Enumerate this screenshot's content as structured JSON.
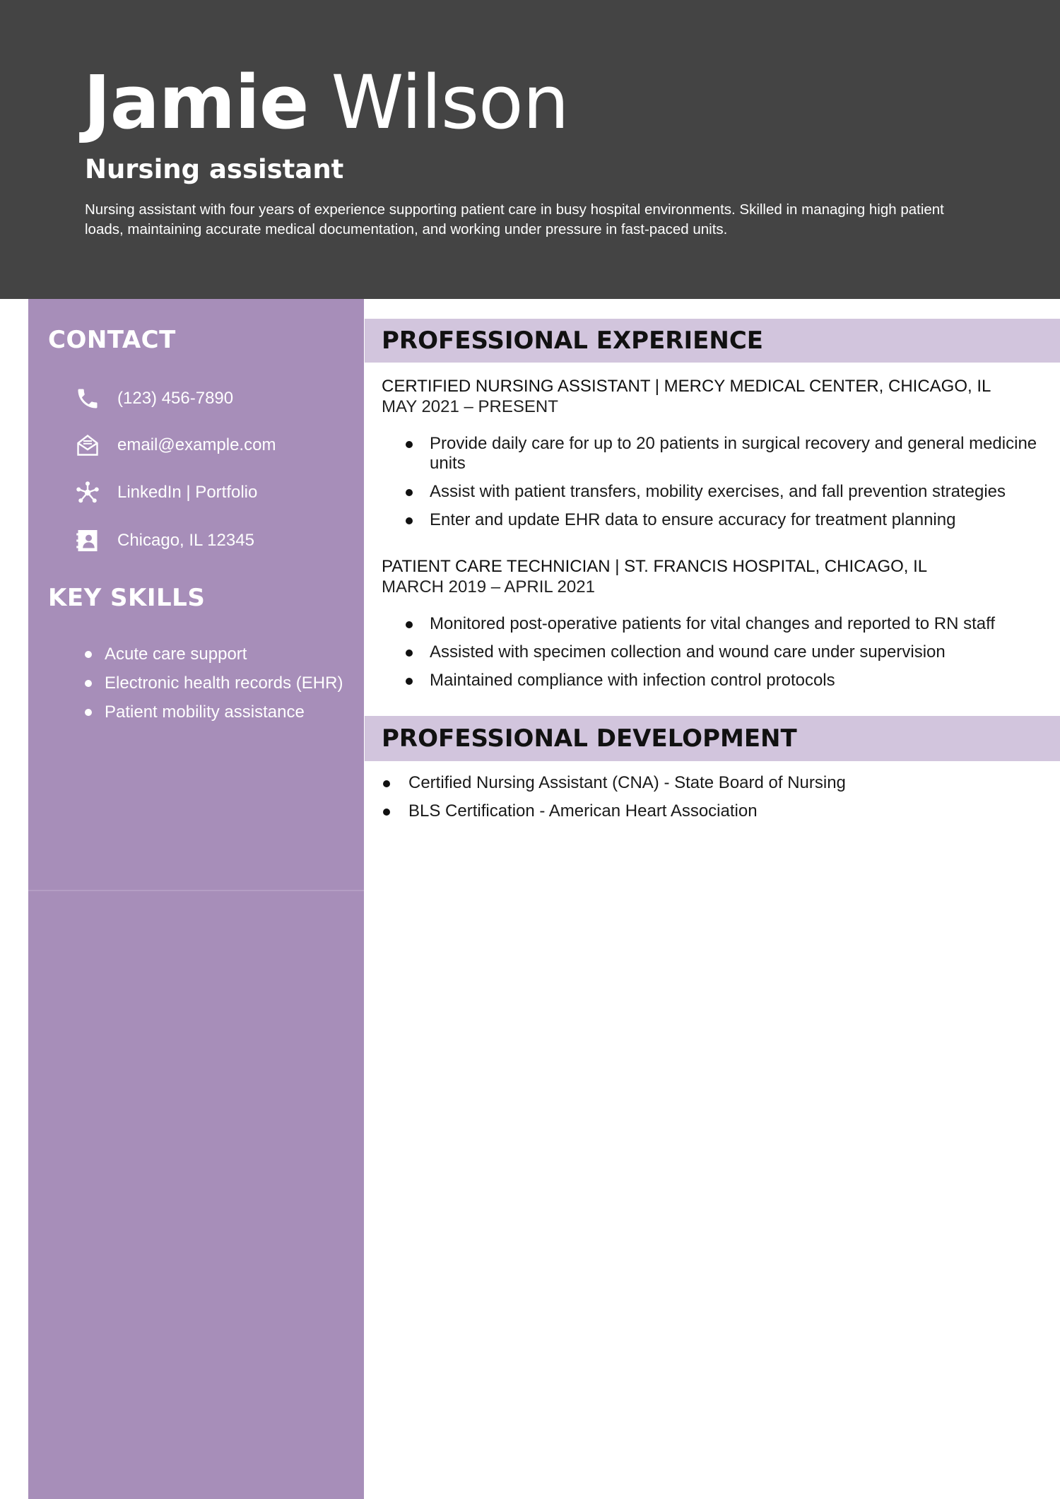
{
  "header": {
    "first_name": "Jamie",
    "last_name": "Wilson",
    "title": "Nursing assistant",
    "summary": "Nursing assistant with four years of experience supporting patient care in busy hospital environments. Skilled in managing high patient loads, maintaining accurate medical documentation, and working under pressure in fast-paced units."
  },
  "sidebar": {
    "contact_heading": "CONTACT",
    "contact": [
      {
        "icon": "phone-icon",
        "text": "(123) 456-7890"
      },
      {
        "icon": "envelope-icon",
        "text": "email@example.com"
      },
      {
        "icon": "network-icon",
        "text": "LinkedIn | Portfolio"
      },
      {
        "icon": "contact-card-icon",
        "text": "Chicago, IL 12345"
      }
    ],
    "skills_heading": "KEY SKILLS",
    "skills": [
      "Acute care support",
      "Electronic health records (EHR)",
      "Patient mobility assistance"
    ]
  },
  "experience": {
    "heading": "PROFESSIONAL EXPERIENCE",
    "jobs": [
      {
        "role": "CERTIFIED NURSING ASSISTANT | MERCY MEDICAL CENTER, CHICAGO, IL",
        "dates": "MAY 2021 – PRESENT",
        "bullets": [
          "Provide daily care for up to 20 patients in surgical recovery and general medicine units",
          "Assist with patient transfers, mobility exercises, and fall prevention strategies",
          "Enter and update EHR data to ensure accuracy for treatment planning"
        ]
      },
      {
        "role": "PATIENT CARE TECHNICIAN | ST. FRANCIS HOSPITAL, CHICAGO, IL",
        "dates": "MARCH 2019 – APRIL 2021",
        "bullets": [
          "Monitored post-operative patients for vital changes and reported to RN staff",
          "Assisted with specimen collection and wound care under supervision",
          "Maintained compliance with infection control protocols"
        ]
      }
    ]
  },
  "development": {
    "heading": "PROFESSIONAL DEVELOPMENT",
    "items": [
      "Certified Nursing Assistant (CNA) - State Board of Nursing",
      "BLS Certification - American Heart Association"
    ]
  },
  "colors": {
    "header_bg": "#444444",
    "sidebar_bg": "#a78eb9",
    "section_bar_bg": "#d2c5dd"
  }
}
